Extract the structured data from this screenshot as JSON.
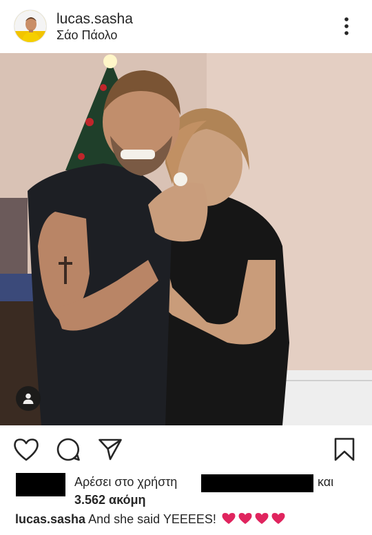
{
  "post": {
    "username": "lucas.sasha",
    "location": "Σάο Πάολο"
  },
  "icons": {
    "more": "more-vertical-icon",
    "tag": "user-tag-icon",
    "like": "heart-icon",
    "comment": "comment-icon",
    "share": "send-icon",
    "save": "bookmark-icon"
  },
  "likes": {
    "prefix": "Αρέσει στο χρήστη",
    "and": "και",
    "count": "3.562 ακόμη"
  },
  "caption": {
    "username": "lucas.sasha",
    "text": "And she said YEEEES!",
    "emoji_count": 4
  },
  "colors": {
    "text": "#262626",
    "heart_red": "#e0245e",
    "redaction": "#000000"
  }
}
